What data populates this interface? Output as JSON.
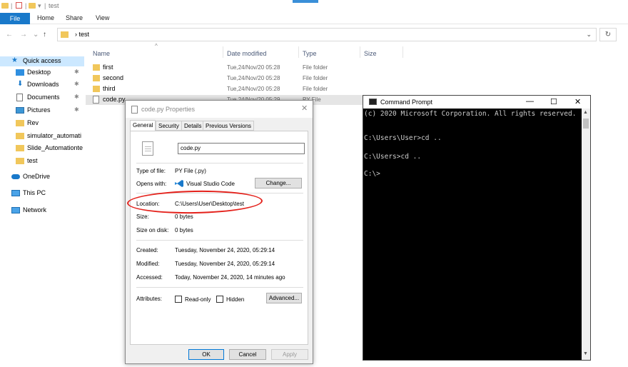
{
  "explorer": {
    "title": "test",
    "ribbon_tabs": [
      "File",
      "Home",
      "Share",
      "View"
    ],
    "address": "test",
    "address_separator": "›",
    "refresh_icon": "refresh-icon",
    "sidebar": [
      {
        "label": "Quick access",
        "icon": "star-icon"
      },
      {
        "label": "Desktop",
        "icon": "desktop-icon",
        "pinned": true
      },
      {
        "label": "Downloads",
        "icon": "download-icon",
        "pinned": true
      },
      {
        "label": "Documents",
        "icon": "documents-icon",
        "pinned": true
      },
      {
        "label": "Pictures",
        "icon": "pictures-icon",
        "pinned": true
      },
      {
        "label": "Rev",
        "icon": "folder-icon"
      },
      {
        "label": "simulator_automati",
        "icon": "folder-icon"
      },
      {
        "label": "Slide_Automationte",
        "icon": "folder-icon"
      },
      {
        "label": "test",
        "icon": "folder-icon"
      },
      {
        "label": "OneDrive",
        "icon": "cloud-icon"
      },
      {
        "label": "This PC",
        "icon": "pc-icon"
      },
      {
        "label": "Network",
        "icon": "network-icon"
      }
    ],
    "columns": [
      "Name",
      "Date modified",
      "Type",
      "Size"
    ],
    "files": [
      {
        "name": "first",
        "date": "Tue,24/Nov/20 05:28",
        "type": "File folder"
      },
      {
        "name": "second",
        "date": "Tue,24/Nov/20 05:28",
        "type": "File folder"
      },
      {
        "name": "third",
        "date": "Tue,24/Nov/20 05:28",
        "type": "File folder"
      },
      {
        "name": "code.py",
        "date": "Tue,24/Nov/20 05:29",
        "type": "PY File"
      }
    ]
  },
  "properties": {
    "title": "code.py Properties",
    "tabs": [
      "General",
      "Security",
      "Details",
      "Previous Versions"
    ],
    "filename": "code.py",
    "labels": {
      "type": "Type of file:",
      "opens": "Opens with:",
      "location": "Location:",
      "size": "Size:",
      "size_on_disk": "Size on disk:",
      "created": "Created:",
      "modified": "Modified:",
      "accessed": "Accessed:",
      "attributes": "Attributes:"
    },
    "values": {
      "type": "PY File (.py)",
      "opens": "Visual Studio Code",
      "location": "C:\\Users\\User\\Desktop\\test",
      "size": "0 bytes",
      "size_on_disk": "0 bytes",
      "created": "Tuesday, November 24, 2020, 05:29:14",
      "modified": "Tuesday, November 24, 2020, 05:29:14",
      "accessed": "Today, November 24, 2020, 14 minutes ago"
    },
    "buttons": {
      "change": "Change...",
      "advanced": "Advanced...",
      "ok": "OK",
      "cancel": "Cancel",
      "apply": "Apply"
    },
    "checkboxes": {
      "readonly": "Read-only",
      "hidden": "Hidden"
    }
  },
  "cmd": {
    "title": "Command Prompt",
    "lines": [
      "(c) 2020 Microsoft Corporation. All rights reserved.",
      "",
      "C:\\Users\\User>cd ..",
      "",
      "C:\\Users>cd ..",
      "",
      "C:\\>"
    ],
    "controls": [
      "—",
      "☐",
      "✕"
    ]
  },
  "colors": {
    "accent": "#1979ca",
    "folder": "#f1c75b",
    "annotation": "#e4211b"
  }
}
